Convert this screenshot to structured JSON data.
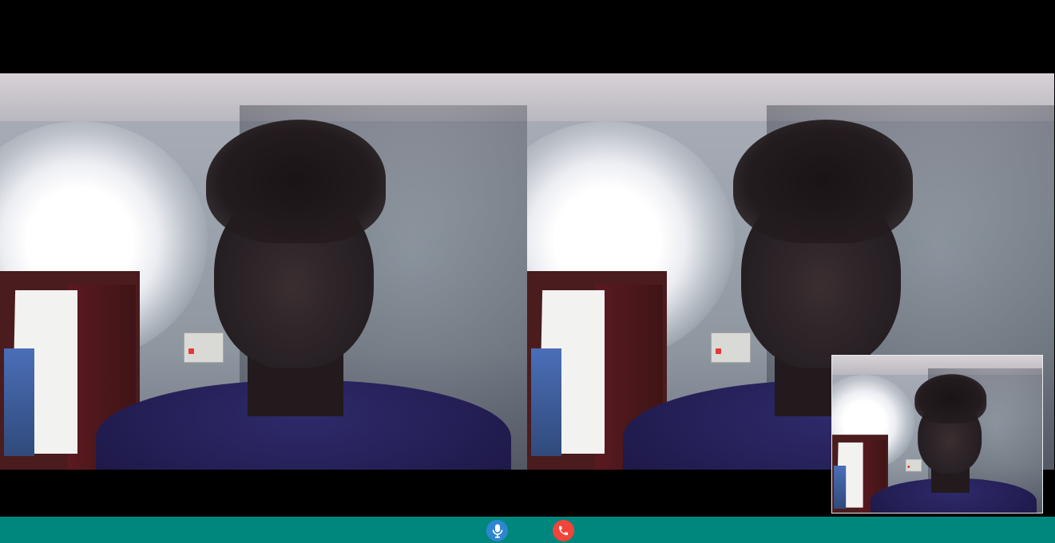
{
  "call": {
    "remote_video_label": "",
    "local_video_label": "",
    "self_view_label": ""
  },
  "controls": {
    "mute_icon": "microphone-icon",
    "end_call_icon": "phone-icon"
  },
  "colors": {
    "toolbar_bg": "#00877d",
    "mic_button": "#2f86d0",
    "end_call_button": "#f1443a",
    "stage_bg": "#000000"
  }
}
